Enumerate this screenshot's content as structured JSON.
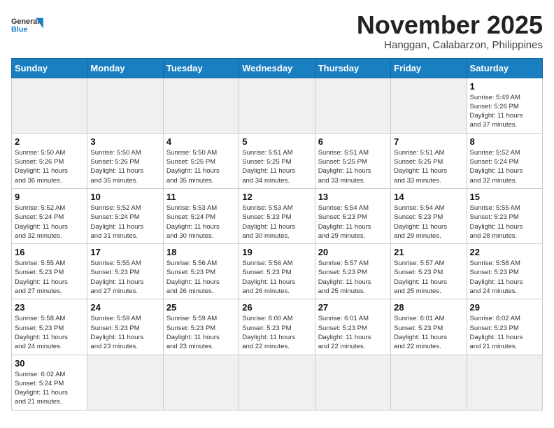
{
  "header": {
    "logo_general": "General",
    "logo_blue": "Blue",
    "month_year": "November 2025",
    "location": "Hanggan, Calabarzon, Philippines"
  },
  "weekdays": [
    "Sunday",
    "Monday",
    "Tuesday",
    "Wednesday",
    "Thursday",
    "Friday",
    "Saturday"
  ],
  "days": [
    {
      "date": "",
      "info": ""
    },
    {
      "date": "",
      "info": ""
    },
    {
      "date": "",
      "info": ""
    },
    {
      "date": "",
      "info": ""
    },
    {
      "date": "",
      "info": ""
    },
    {
      "date": "",
      "info": ""
    },
    {
      "date": "1",
      "info": "Sunrise: 5:49 AM\nSunset: 5:26 PM\nDaylight: 11 hours\nand 37 minutes."
    },
    {
      "date": "2",
      "info": "Sunrise: 5:50 AM\nSunset: 5:26 PM\nDaylight: 11 hours\nand 36 minutes."
    },
    {
      "date": "3",
      "info": "Sunrise: 5:50 AM\nSunset: 5:26 PM\nDaylight: 11 hours\nand 35 minutes."
    },
    {
      "date": "4",
      "info": "Sunrise: 5:50 AM\nSunset: 5:25 PM\nDaylight: 11 hours\nand 35 minutes."
    },
    {
      "date": "5",
      "info": "Sunrise: 5:51 AM\nSunset: 5:25 PM\nDaylight: 11 hours\nand 34 minutes."
    },
    {
      "date": "6",
      "info": "Sunrise: 5:51 AM\nSunset: 5:25 PM\nDaylight: 11 hours\nand 33 minutes."
    },
    {
      "date": "7",
      "info": "Sunrise: 5:51 AM\nSunset: 5:25 PM\nDaylight: 11 hours\nand 33 minutes."
    },
    {
      "date": "8",
      "info": "Sunrise: 5:52 AM\nSunset: 5:24 PM\nDaylight: 11 hours\nand 32 minutes."
    },
    {
      "date": "9",
      "info": "Sunrise: 5:52 AM\nSunset: 5:24 PM\nDaylight: 11 hours\nand 32 minutes."
    },
    {
      "date": "10",
      "info": "Sunrise: 5:52 AM\nSunset: 5:24 PM\nDaylight: 11 hours\nand 31 minutes."
    },
    {
      "date": "11",
      "info": "Sunrise: 5:53 AM\nSunset: 5:24 PM\nDaylight: 11 hours\nand 30 minutes."
    },
    {
      "date": "12",
      "info": "Sunrise: 5:53 AM\nSunset: 5:23 PM\nDaylight: 11 hours\nand 30 minutes."
    },
    {
      "date": "13",
      "info": "Sunrise: 5:54 AM\nSunset: 5:23 PM\nDaylight: 11 hours\nand 29 minutes."
    },
    {
      "date": "14",
      "info": "Sunrise: 5:54 AM\nSunset: 5:23 PM\nDaylight: 11 hours\nand 29 minutes."
    },
    {
      "date": "15",
      "info": "Sunrise: 5:55 AM\nSunset: 5:23 PM\nDaylight: 11 hours\nand 28 minutes."
    },
    {
      "date": "16",
      "info": "Sunrise: 5:55 AM\nSunset: 5:23 PM\nDaylight: 11 hours\nand 27 minutes."
    },
    {
      "date": "17",
      "info": "Sunrise: 5:55 AM\nSunset: 5:23 PM\nDaylight: 11 hours\nand 27 minutes."
    },
    {
      "date": "18",
      "info": "Sunrise: 5:56 AM\nSunset: 5:23 PM\nDaylight: 11 hours\nand 26 minutes."
    },
    {
      "date": "19",
      "info": "Sunrise: 5:56 AM\nSunset: 5:23 PM\nDaylight: 11 hours\nand 26 minutes."
    },
    {
      "date": "20",
      "info": "Sunrise: 5:57 AM\nSunset: 5:23 PM\nDaylight: 11 hours\nand 25 minutes."
    },
    {
      "date": "21",
      "info": "Sunrise: 5:57 AM\nSunset: 5:23 PM\nDaylight: 11 hours\nand 25 minutes."
    },
    {
      "date": "22",
      "info": "Sunrise: 5:58 AM\nSunset: 5:23 PM\nDaylight: 11 hours\nand 24 minutes."
    },
    {
      "date": "23",
      "info": "Sunrise: 5:58 AM\nSunset: 5:23 PM\nDaylight: 11 hours\nand 24 minutes."
    },
    {
      "date": "24",
      "info": "Sunrise: 5:59 AM\nSunset: 5:23 PM\nDaylight: 11 hours\nand 23 minutes."
    },
    {
      "date": "25",
      "info": "Sunrise: 5:59 AM\nSunset: 5:23 PM\nDaylight: 11 hours\nand 23 minutes."
    },
    {
      "date": "26",
      "info": "Sunrise: 6:00 AM\nSunset: 5:23 PM\nDaylight: 11 hours\nand 22 minutes."
    },
    {
      "date": "27",
      "info": "Sunrise: 6:01 AM\nSunset: 5:23 PM\nDaylight: 11 hours\nand 22 minutes."
    },
    {
      "date": "28",
      "info": "Sunrise: 6:01 AM\nSunset: 5:23 PM\nDaylight: 11 hours\nand 22 minutes."
    },
    {
      "date": "29",
      "info": "Sunrise: 6:02 AM\nSunset: 5:23 PM\nDaylight: 11 hours\nand 21 minutes."
    },
    {
      "date": "30",
      "info": "Sunrise: 6:02 AM\nSunset: 5:24 PM\nDaylight: 11 hours\nand 21 minutes."
    },
    {
      "date": "",
      "info": ""
    },
    {
      "date": "",
      "info": ""
    },
    {
      "date": "",
      "info": ""
    },
    {
      "date": "",
      "info": ""
    },
    {
      "date": "",
      "info": ""
    },
    {
      "date": "",
      "info": ""
    }
  ]
}
